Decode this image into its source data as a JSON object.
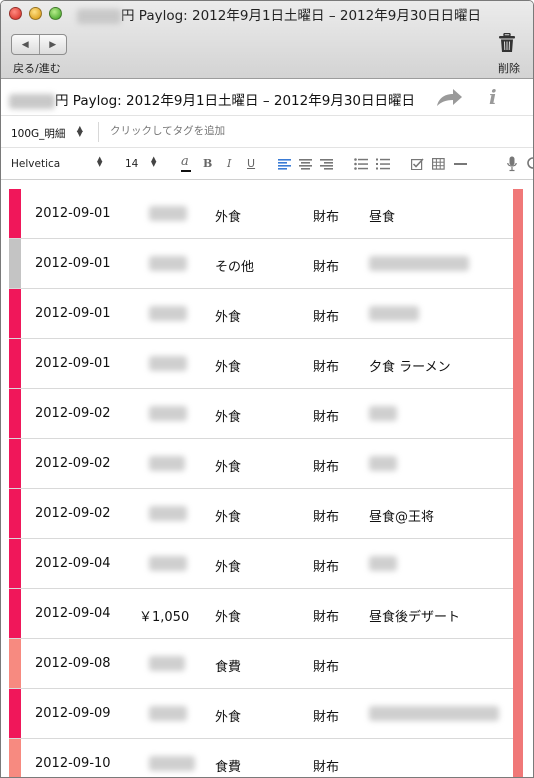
{
  "window": {
    "title_suffix": "円 Paylog: 2012年9月1日土曜日 – 2012年9月30日日曜日",
    "nav_label": "戻る/進む",
    "delete_label": "削除"
  },
  "note": {
    "title_suffix": "円 Paylog: 2012年9月1日土曜日 – 2012年9月30日日曜日",
    "notebook": "100G_明細",
    "tag_placeholder": "クリックしてタグを追加"
  },
  "format": {
    "font": "Helvetica",
    "size": "14"
  },
  "colors": {
    "swatch_pink": "#f0175a",
    "swatch_gray": "#c4c4c4",
    "swatch_salmon": "#f78a80",
    "right_bar": "#f07878"
  },
  "rows": [
    {
      "date": "2012-09-01",
      "amount": "",
      "category": "外食",
      "wallet": "財布",
      "memo": "昼食",
      "swatch": "pink"
    },
    {
      "date": "2012-09-01",
      "amount": "",
      "category": "その他",
      "wallet": "財布",
      "memo": "",
      "swatch": "gray"
    },
    {
      "date": "2012-09-01",
      "amount": "",
      "category": "外食",
      "wallet": "財布",
      "memo": "",
      "swatch": "pink"
    },
    {
      "date": "2012-09-01",
      "amount": "",
      "category": "外食",
      "wallet": "財布",
      "memo": "夕食 ラーメン",
      "swatch": "pink"
    },
    {
      "date": "2012-09-02",
      "amount": "",
      "category": "外食",
      "wallet": "財布",
      "memo": "",
      "swatch": "pink"
    },
    {
      "date": "2012-09-02",
      "amount": "",
      "category": "外食",
      "wallet": "財布",
      "memo": "",
      "swatch": "pink"
    },
    {
      "date": "2012-09-02",
      "amount": "",
      "category": "外食",
      "wallet": "財布",
      "memo": "昼食@王将",
      "swatch": "pink"
    },
    {
      "date": "2012-09-04",
      "amount": "",
      "category": "外食",
      "wallet": "財布",
      "memo": "",
      "swatch": "pink"
    },
    {
      "date": "2012-09-04",
      "amount": "￥1,050",
      "category": "外食",
      "wallet": "財布",
      "memo": "昼食後デザート",
      "swatch": "pink"
    },
    {
      "date": "2012-09-08",
      "amount": "",
      "category": "食費",
      "wallet": "財布",
      "memo": "",
      "swatch": "salmon"
    },
    {
      "date": "2012-09-09",
      "amount": "",
      "category": "外食",
      "wallet": "財布",
      "memo": "",
      "swatch": "pink"
    },
    {
      "date": "2012-09-10",
      "amount": "",
      "category": "食費",
      "wallet": "財布",
      "memo": "",
      "swatch": "salmon"
    }
  ]
}
